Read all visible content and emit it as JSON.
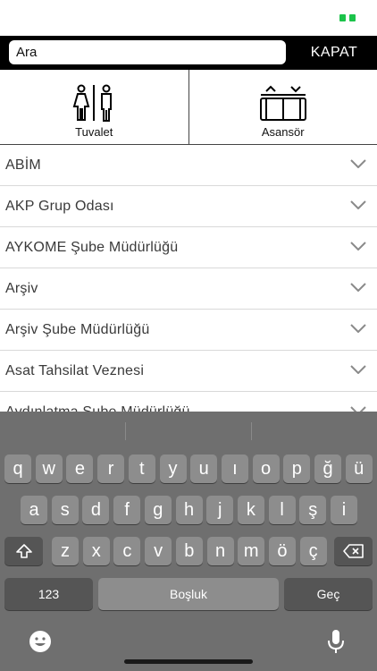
{
  "status_bar": {
    "battery_color": "#1bc34a"
  },
  "search": {
    "value": "Ara",
    "close_label": "KAPAT"
  },
  "quick_tiles": [
    {
      "label": "Tuvalet",
      "icon": "restroom-icon"
    },
    {
      "label": "Asansör",
      "icon": "elevator-icon"
    }
  ],
  "list": {
    "items": [
      {
        "label": "ABİM"
      },
      {
        "label": "AKP Grup Odası"
      },
      {
        "label": "AYKOME Şube Müdürlüğü"
      },
      {
        "label": "Arşiv"
      },
      {
        "label": "Arşiv Şube Müdürlüğü"
      },
      {
        "label": "Asat Tahsilat Veznesi"
      },
      {
        "label": "Aydınlatma Şube Müdürlüğü"
      }
    ]
  },
  "keyboard": {
    "row1": [
      "q",
      "w",
      "e",
      "r",
      "t",
      "y",
      "u",
      "ı",
      "o",
      "p",
      "ğ",
      "ü"
    ],
    "row2": [
      "a",
      "s",
      "d",
      "f",
      "g",
      "h",
      "j",
      "k",
      "l",
      "ş",
      "i"
    ],
    "row3": [
      "z",
      "x",
      "c",
      "v",
      "b",
      "n",
      "m",
      "ö",
      "ç"
    ],
    "numbers_label": "123",
    "space_label": "Boşluk",
    "return_label": "Geç"
  },
  "colors": {
    "accent": "#000000",
    "keyboard_bg": "#6f6f6f",
    "key_bg": "#8d8d8d",
    "dark_key_bg": "#555555"
  }
}
